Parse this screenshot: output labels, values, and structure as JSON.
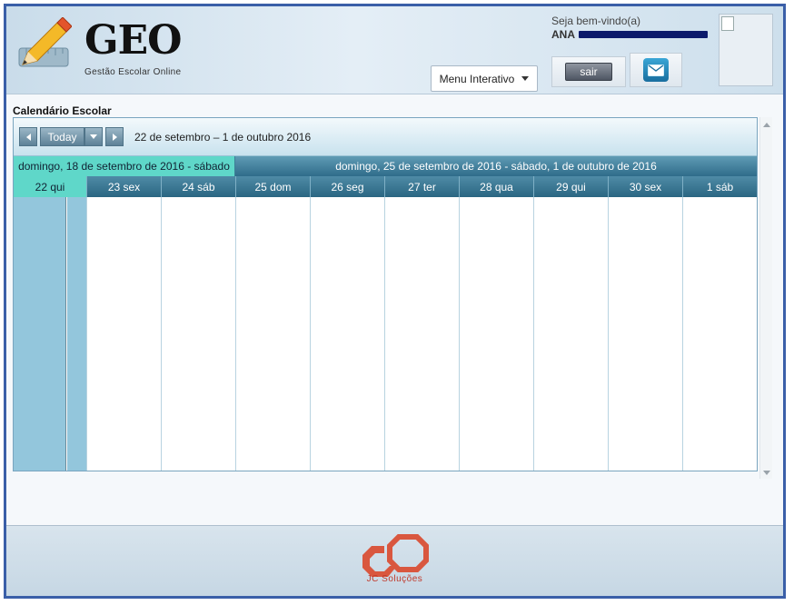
{
  "header": {
    "logo_text": "GEO",
    "logo_sub": "Gestão Escolar Online",
    "menu_label": "Menu Interativo",
    "welcome": "Seja bem-vindo(a)",
    "user_first": "ANA",
    "logout_label": "sair"
  },
  "calendar": {
    "section_title": "Calendário Escolar",
    "today_label": "Today",
    "range_label": "22 de setembro – 1 de outubro 2016",
    "weeks": [
      "domingo, 18 de setembro de 2016 - sábado",
      "domingo, 25 de setembro de 2016 - sábado, 1 de outubro de 2016"
    ],
    "days": [
      "22 qui",
      "23 sex",
      "24 sáb",
      "25 dom",
      "26 seg",
      "27 ter",
      "28 qua",
      "29 qui",
      "30 sex",
      "1 sáb"
    ]
  },
  "footer": {
    "brand": "JC Soluções"
  },
  "colors": {
    "frame_border": "#3a5fa8",
    "header_bar": "#2a6682",
    "highlight": "#5fd7c9",
    "footer_brand": "#c0392b"
  }
}
